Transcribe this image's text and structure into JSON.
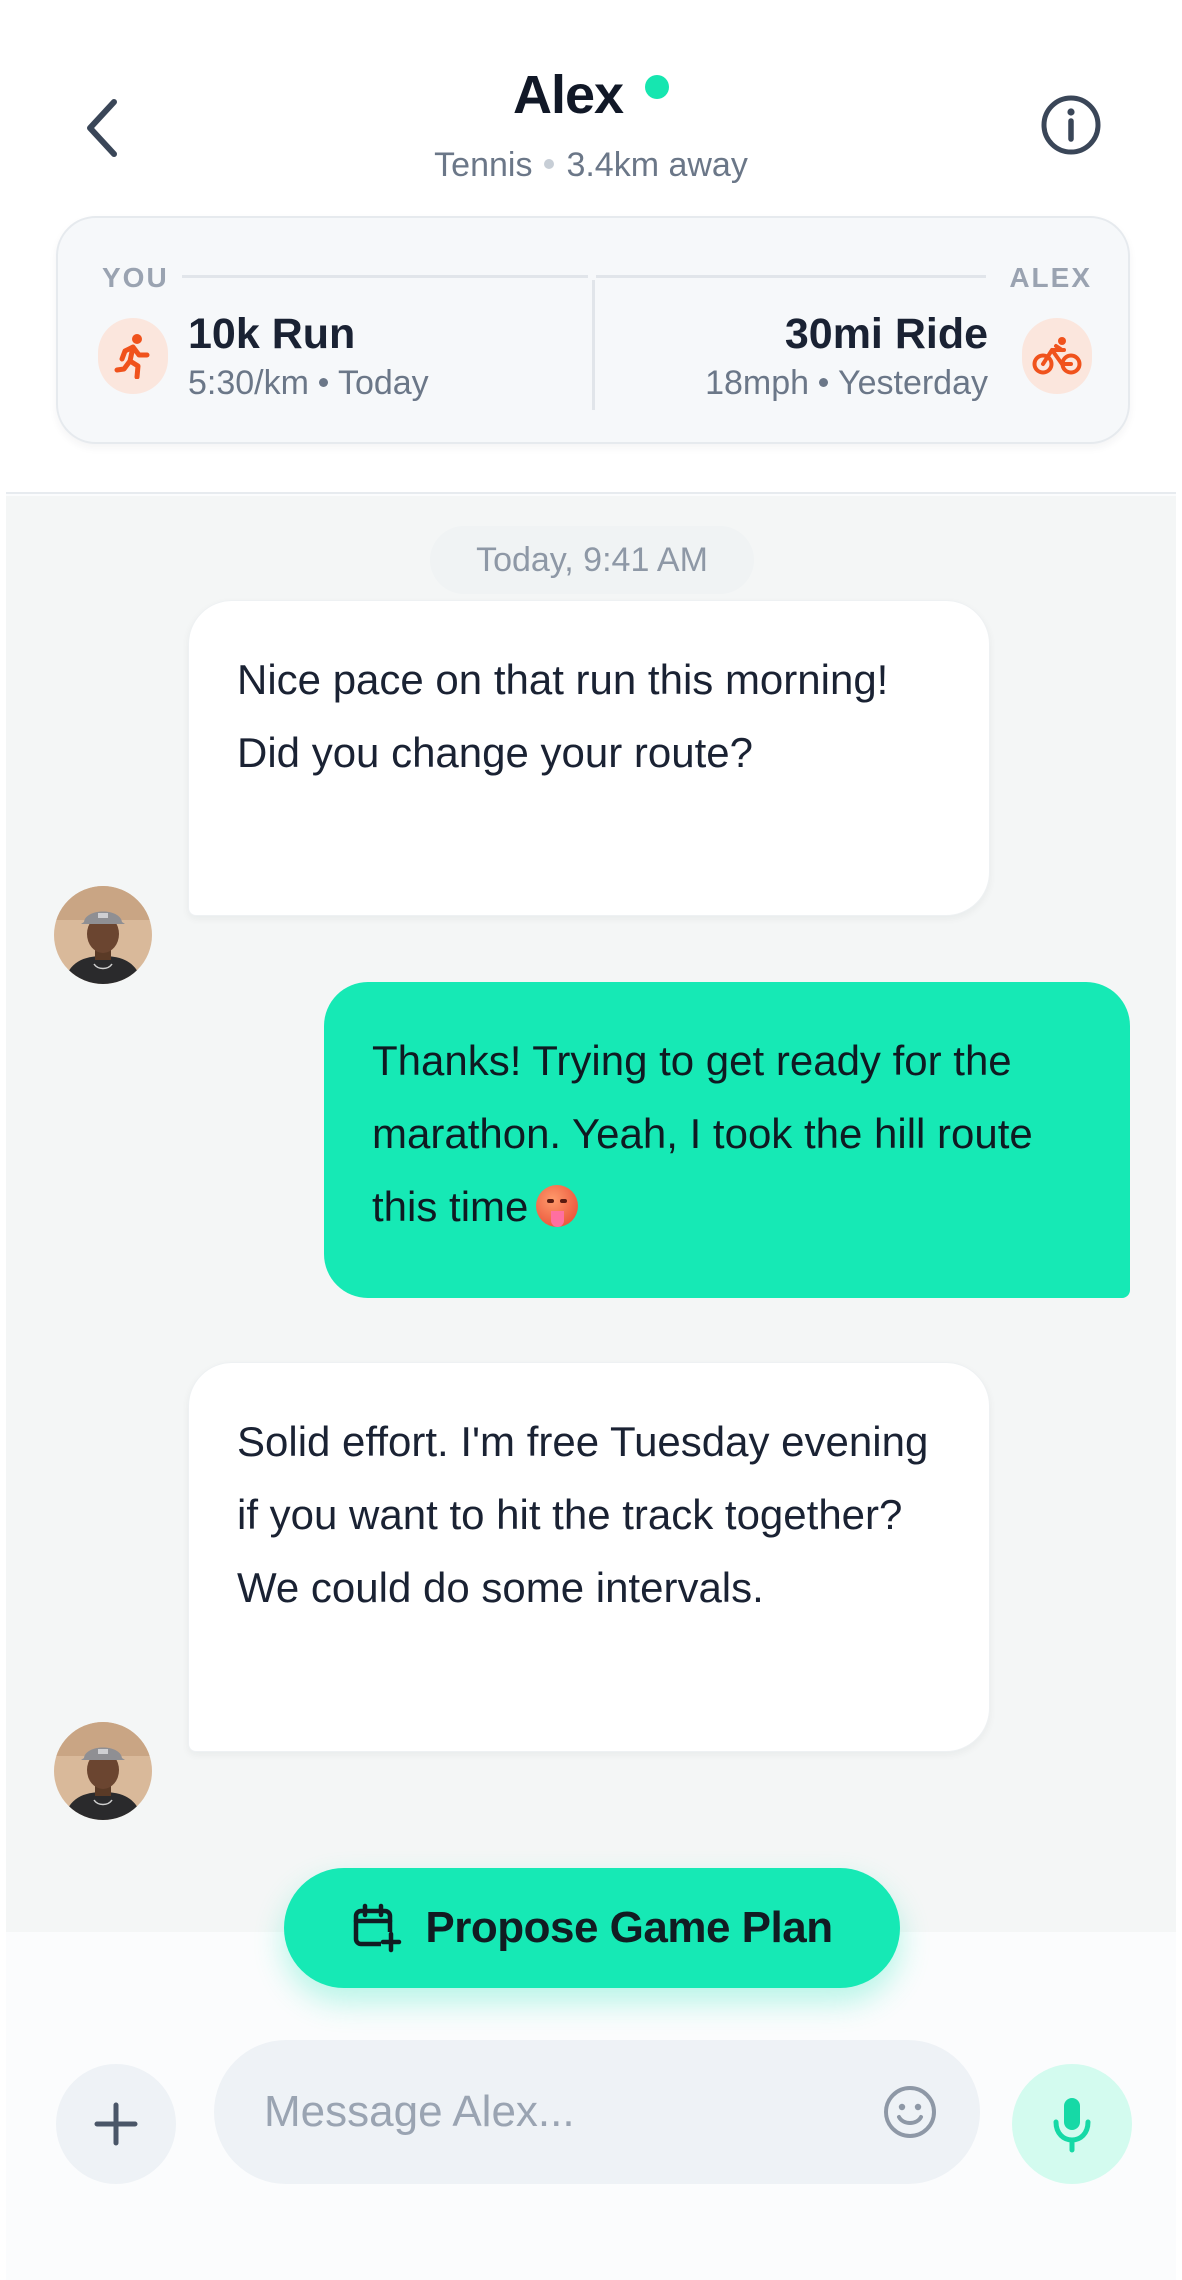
{
  "header": {
    "contact_name": "Alex",
    "sport": "Tennis",
    "distance": "3.4km away",
    "online": true,
    "colors": {
      "accent": "#16e9b5",
      "online": "#16e6b0",
      "activity_icon": "#f0521c"
    }
  },
  "comparison": {
    "you_label": "YOU",
    "alex_label": "ALEX",
    "you": {
      "title": "10k Run",
      "stat": "5:30/km",
      "when": "Today",
      "icon": "running-icon"
    },
    "alex": {
      "title": "30mi Ride",
      "stat": "18mph",
      "when": "Yesterday",
      "icon": "cycling-icon"
    }
  },
  "chat": {
    "timestamp": "Today, 9:41 AM",
    "messages": [
      {
        "from": "Alex",
        "direction": "incoming",
        "text": "Nice pace on that run this morning! Did you change your route?"
      },
      {
        "from": "You",
        "direction": "outgoing",
        "text": "Thanks! Trying to get ready for the marathon. Yeah, I took the hill route this time",
        "emoji": "hot-face"
      },
      {
        "from": "Alex",
        "direction": "incoming",
        "text": "Solid effort. I'm free Tuesday evening if you want to hit the track together? We could do some intervals."
      }
    ]
  },
  "cta": {
    "label": "Propose Game Plan",
    "icon": "calendar-plus-icon"
  },
  "composer": {
    "placeholder": "Message Alex...",
    "value": ""
  }
}
